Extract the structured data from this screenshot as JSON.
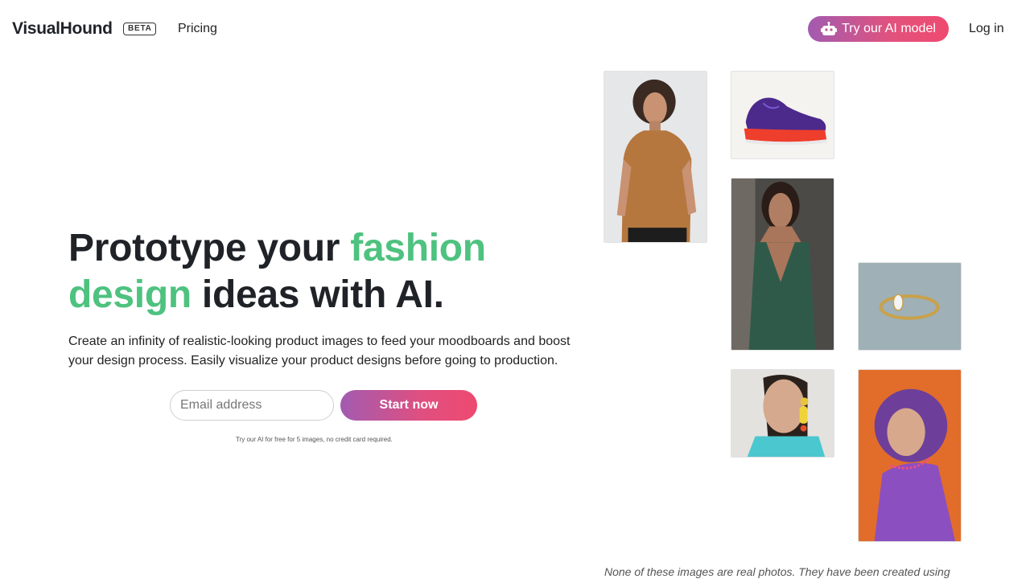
{
  "header": {
    "logo": "VisualHound",
    "beta_badge": "BETA",
    "nav_pricing": "Pricing",
    "try_ai_button": "Try our AI model",
    "try_ai_icon": "robot-icon",
    "login": "Log in"
  },
  "hero": {
    "headline_part1": "Prototype your ",
    "headline_accent1": "fashion",
    "headline_accent2": "design",
    "headline_part2": " ideas with AI.",
    "subtext": "Create an infinity of realistic-looking product images to feed your moodboards and boost your design process. Easily visualize your product designs before going to production.",
    "email_placeholder": "Email address",
    "start_button": "Start now",
    "fine_print": "Try our AI for free for 5 images, no credit card required."
  },
  "gallery": {
    "images": [
      "man-orange-tshirt-image",
      "sneaker-image",
      "woman-green-dress-image",
      "gold-ring-image",
      "woman-earring-image",
      "woman-purple-hair-image"
    ],
    "caption": "None of these images are real photos. They have been created using"
  },
  "colors": {
    "accent_green": "#4ec27f",
    "gradient_start": "#a25bb0",
    "gradient_end": "#ee4a70",
    "text_dark": "#1f2328"
  }
}
